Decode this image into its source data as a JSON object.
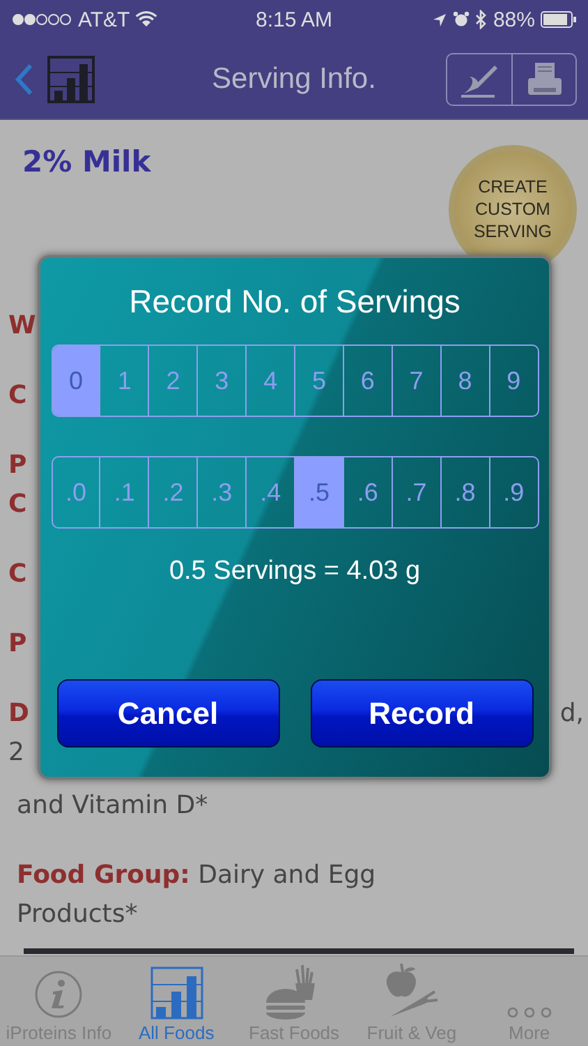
{
  "status_bar": {
    "carrier": "AT&T",
    "time": "8:15 AM",
    "battery": "88%"
  },
  "nav": {
    "title": "Serving Info."
  },
  "food": {
    "name": "2% Milk",
    "badge_lines": [
      "CREATE",
      "CUSTOM",
      "SERVING"
    ]
  },
  "details": [
    {
      "lines": [
        {
          "label": "W"
        }
      ]
    },
    {
      "lines": [
        {
          "label": "C"
        }
      ]
    },
    {
      "lines": [
        {
          "label": "P"
        },
        {
          "label": "C"
        }
      ]
    },
    {
      "lines": [
        {
          "label": "C"
        }
      ]
    },
    {
      "lines": [
        {
          "label": "P"
        }
      ]
    },
    {
      "lines": [
        {
          "label": "D",
          "right": "d,"
        },
        {
          "text": "2"
        },
        {
          "text": "and Vitamin D*"
        }
      ]
    },
    {
      "lines": [
        {
          "label": "Food Group:",
          "text": "Dairy and Egg"
        },
        {
          "text": "Products*"
        }
      ]
    }
  ],
  "dialog": {
    "title": "Record No. of Servings",
    "whole": [
      {
        "label": "0",
        "selected": true
      },
      {
        "label": "1",
        "selected": false
      },
      {
        "label": "2",
        "selected": false
      },
      {
        "label": "3",
        "selected": false
      },
      {
        "label": "4",
        "selected": false
      },
      {
        "label": "5",
        "selected": false
      },
      {
        "label": "6",
        "selected": false
      },
      {
        "label": "7",
        "selected": false
      },
      {
        "label": "8",
        "selected": false
      },
      {
        "label": "9",
        "selected": false
      }
    ],
    "tenths": [
      {
        "label": ".0",
        "selected": false
      },
      {
        "label": ".1",
        "selected": false
      },
      {
        "label": ".2",
        "selected": false
      },
      {
        "label": ".3",
        "selected": false
      },
      {
        "label": ".4",
        "selected": false
      },
      {
        "label": ".5",
        "selected": true
      },
      {
        "label": ".6",
        "selected": false
      },
      {
        "label": ".7",
        "selected": false
      },
      {
        "label": ".8",
        "selected": false
      },
      {
        "label": ".9",
        "selected": false
      }
    ],
    "result": "0.5 Servings = 4.03 g",
    "buttons": [
      "Cancel",
      "Record"
    ]
  },
  "tabs": [
    {
      "label": "iProteins Info",
      "kind": "info",
      "selected": false
    },
    {
      "label": "All Foods",
      "kind": "chart",
      "selected": true
    },
    {
      "label": "Fast Foods",
      "kind": "fastfood",
      "selected": false
    },
    {
      "label": "Fruit & Veg",
      "kind": "produce",
      "selected": false
    },
    {
      "label": "More",
      "kind": "more",
      "selected": false
    }
  ]
}
